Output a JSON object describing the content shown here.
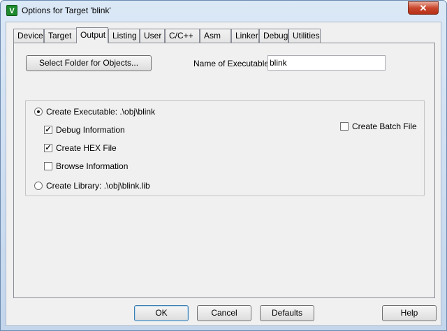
{
  "window": {
    "title": "Options for Target 'blink'",
    "icon_glyph": "V",
    "close_glyph": "✕"
  },
  "tabs": [
    {
      "label": "Device"
    },
    {
      "label": "Target"
    },
    {
      "label": "Output"
    },
    {
      "label": "Listing"
    },
    {
      "label": "User"
    },
    {
      "label": "C/C++"
    },
    {
      "label": "Asm"
    },
    {
      "label": "Linker"
    },
    {
      "label": "Debug"
    },
    {
      "label": "Utilities"
    }
  ],
  "active_tab": "Output",
  "output": {
    "select_folder_label": "Select Folder for Objects...",
    "name_label": "Name of Executable:",
    "name_value": "blink",
    "create_exe_label": "Create Executable:  .\\obj\\blink",
    "debug_info_label": "Debug Information",
    "create_hex_label": "Create HEX File",
    "browse_info_label": "Browse Information",
    "create_batch_label": "Create Batch File",
    "create_lib_label": "Create Library:  .\\obj\\blink.lib",
    "check_glyph": "✓",
    "states": {
      "create_executable": true,
      "debug_information": true,
      "create_hex_file": true,
      "browse_information": false,
      "create_batch_file": false,
      "create_library": false
    }
  },
  "footer": {
    "ok": "OK",
    "cancel": "Cancel",
    "defaults": "Defaults",
    "help": "Help"
  }
}
